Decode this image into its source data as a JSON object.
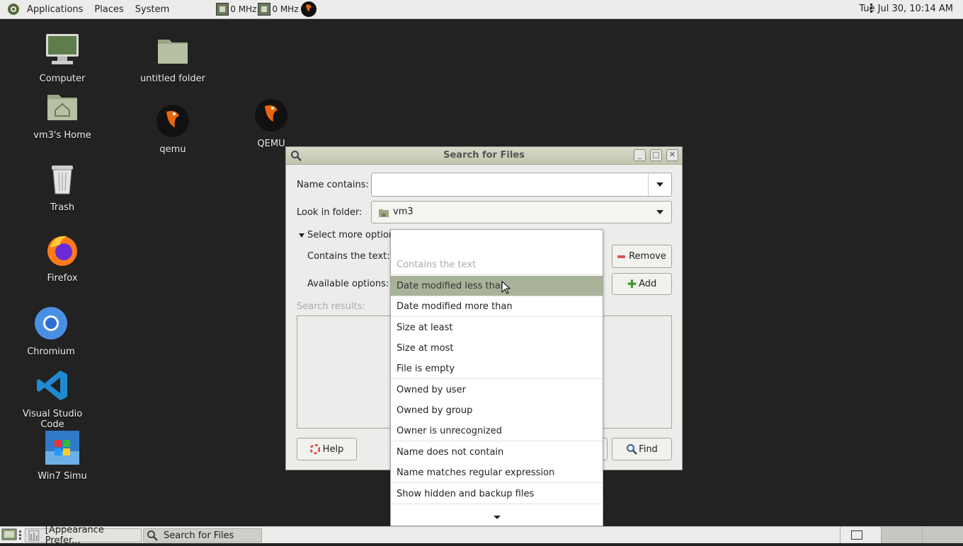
{
  "top_panel": {
    "menus": [
      "Applications",
      "Places",
      "System"
    ],
    "cpu1": "0 MHz",
    "cpu2": "0 MHz",
    "clock": "Tue Jul 30, 10:14 AM"
  },
  "desktop": {
    "icons": [
      {
        "label": "Computer"
      },
      {
        "label": "untitled folder"
      },
      {
        "label": "vm3's Home"
      },
      {
        "label": "qemu"
      },
      {
        "label": "QEMU"
      },
      {
        "label": "Trash"
      },
      {
        "label": "Firefox"
      },
      {
        "label": "Chromium"
      },
      {
        "label": "Visual Studio Code"
      },
      {
        "label": "Win7 Simu"
      }
    ]
  },
  "window": {
    "title": "Search for Files",
    "name_contains_label": "Name contains:",
    "name_contains_value": "",
    "look_in_label": "Look in folder:",
    "look_in_value": "vm3",
    "more_options_label": "Select more options",
    "contains_text_label": "Contains the text:",
    "available_options_label": "Available options:",
    "search_results_label": "Search results:",
    "remove_label": "Remove",
    "add_label": "Add",
    "help_label": "Help",
    "find_label": "Find"
  },
  "popup": {
    "placeholder": "Contains the text",
    "options": [
      "Date modified less than",
      "Date modified more than",
      "Size at least",
      "Size at most",
      "File is empty",
      "Owned by user",
      "Owned by group",
      "Owner is unrecognized",
      "Name does not contain",
      "Name matches regular expression",
      "Show hidden and backup files"
    ],
    "highlighted": "Date modified less than"
  },
  "taskbar": {
    "tasks": [
      "[Appearance Prefer...",
      "Search for Files"
    ]
  },
  "colors": {
    "desktop_bg": "#222222",
    "panel_bg": "#ececea",
    "titlebar": "#c7cdb5",
    "highlight": "#a9b39a"
  }
}
